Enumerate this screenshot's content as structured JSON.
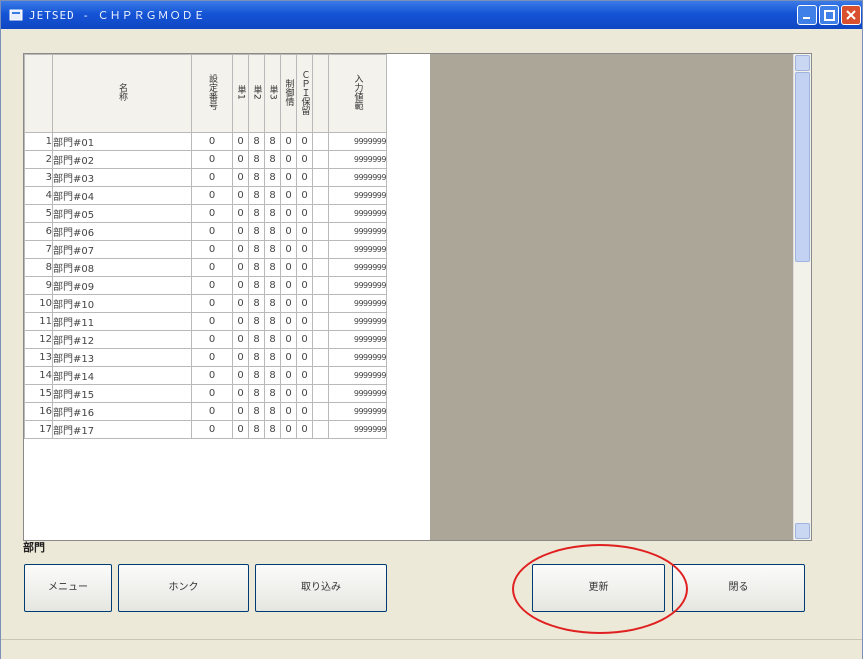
{
  "window": {
    "title": "JETSED - ＣＨＰＲＧＭＯＤＥ",
    "title_icon": "app-icon",
    "controls": [
      "minimize-icon",
      "maximize-icon",
      "close-icon"
    ]
  },
  "grid": {
    "columns": [
      "名称",
      "設定番号",
      "単1",
      "単2",
      "単3",
      "制御情",
      "ＣＰＩ保留",
      "入力値範"
    ],
    "rows": [
      {
        "no": "1",
        "name": "部門#01",
        "v": [
          "0",
          "0",
          "8",
          "8",
          "0",
          "0"
        ],
        "input": "9999999"
      },
      {
        "no": "2",
        "name": "部門#02",
        "v": [
          "0",
          "0",
          "8",
          "8",
          "0",
          "0"
        ],
        "input": "9999999"
      },
      {
        "no": "3",
        "name": "部門#03",
        "v": [
          "0",
          "0",
          "8",
          "8",
          "0",
          "0"
        ],
        "input": "9999999"
      },
      {
        "no": "4",
        "name": "部門#04",
        "v": [
          "0",
          "0",
          "8",
          "8",
          "0",
          "0"
        ],
        "input": "9999999"
      },
      {
        "no": "5",
        "name": "部門#05",
        "v": [
          "0",
          "0",
          "8",
          "8",
          "0",
          "0"
        ],
        "input": "9999999"
      },
      {
        "no": "6",
        "name": "部門#06",
        "v": [
          "0",
          "0",
          "8",
          "8",
          "0",
          "0"
        ],
        "input": "9999999"
      },
      {
        "no": "7",
        "name": "部門#07",
        "v": [
          "0",
          "0",
          "8",
          "8",
          "0",
          "0"
        ],
        "input": "9999999"
      },
      {
        "no": "8",
        "name": "部門#08",
        "v": [
          "0",
          "0",
          "8",
          "8",
          "0",
          "0"
        ],
        "input": "9999999"
      },
      {
        "no": "9",
        "name": "部門#09",
        "v": [
          "0",
          "0",
          "8",
          "8",
          "0",
          "0"
        ],
        "input": "9999999"
      },
      {
        "no": "10",
        "name": "部門#10",
        "v": [
          "0",
          "0",
          "8",
          "8",
          "0",
          "0"
        ],
        "input": "9999999"
      },
      {
        "no": "11",
        "name": "部門#11",
        "v": [
          "0",
          "0",
          "8",
          "8",
          "0",
          "0"
        ],
        "input": "9999999"
      },
      {
        "no": "12",
        "name": "部門#12",
        "v": [
          "0",
          "0",
          "8",
          "8",
          "0",
          "0"
        ],
        "input": "9999999"
      },
      {
        "no": "13",
        "name": "部門#13",
        "v": [
          "0",
          "0",
          "8",
          "8",
          "0",
          "0"
        ],
        "input": "9999999"
      },
      {
        "no": "14",
        "name": "部門#14",
        "v": [
          "0",
          "0",
          "8",
          "8",
          "0",
          "0"
        ],
        "input": "9999999"
      },
      {
        "no": "15",
        "name": "部門#15",
        "v": [
          "0",
          "0",
          "8",
          "8",
          "0",
          "0"
        ],
        "input": "9999999"
      },
      {
        "no": "16",
        "name": "部門#16",
        "v": [
          "0",
          "0",
          "8",
          "8",
          "0",
          "0"
        ],
        "input": "9999999"
      },
      {
        "no": "17",
        "name": "部門#17",
        "v": [
          "0",
          "0",
          "8",
          "8",
          "0",
          "0"
        ],
        "input": "9999999"
      }
    ]
  },
  "section_label": "部門",
  "buttons": {
    "menu": "メニュー",
    "hong": "ホンク",
    "torikomi": "取り込み",
    "koshin": "更新",
    "tojiru": "閉る"
  },
  "colors": {
    "titlebar": "#1554d6",
    "empty_area": "#aca699",
    "highlight_circle": "#e02020"
  }
}
